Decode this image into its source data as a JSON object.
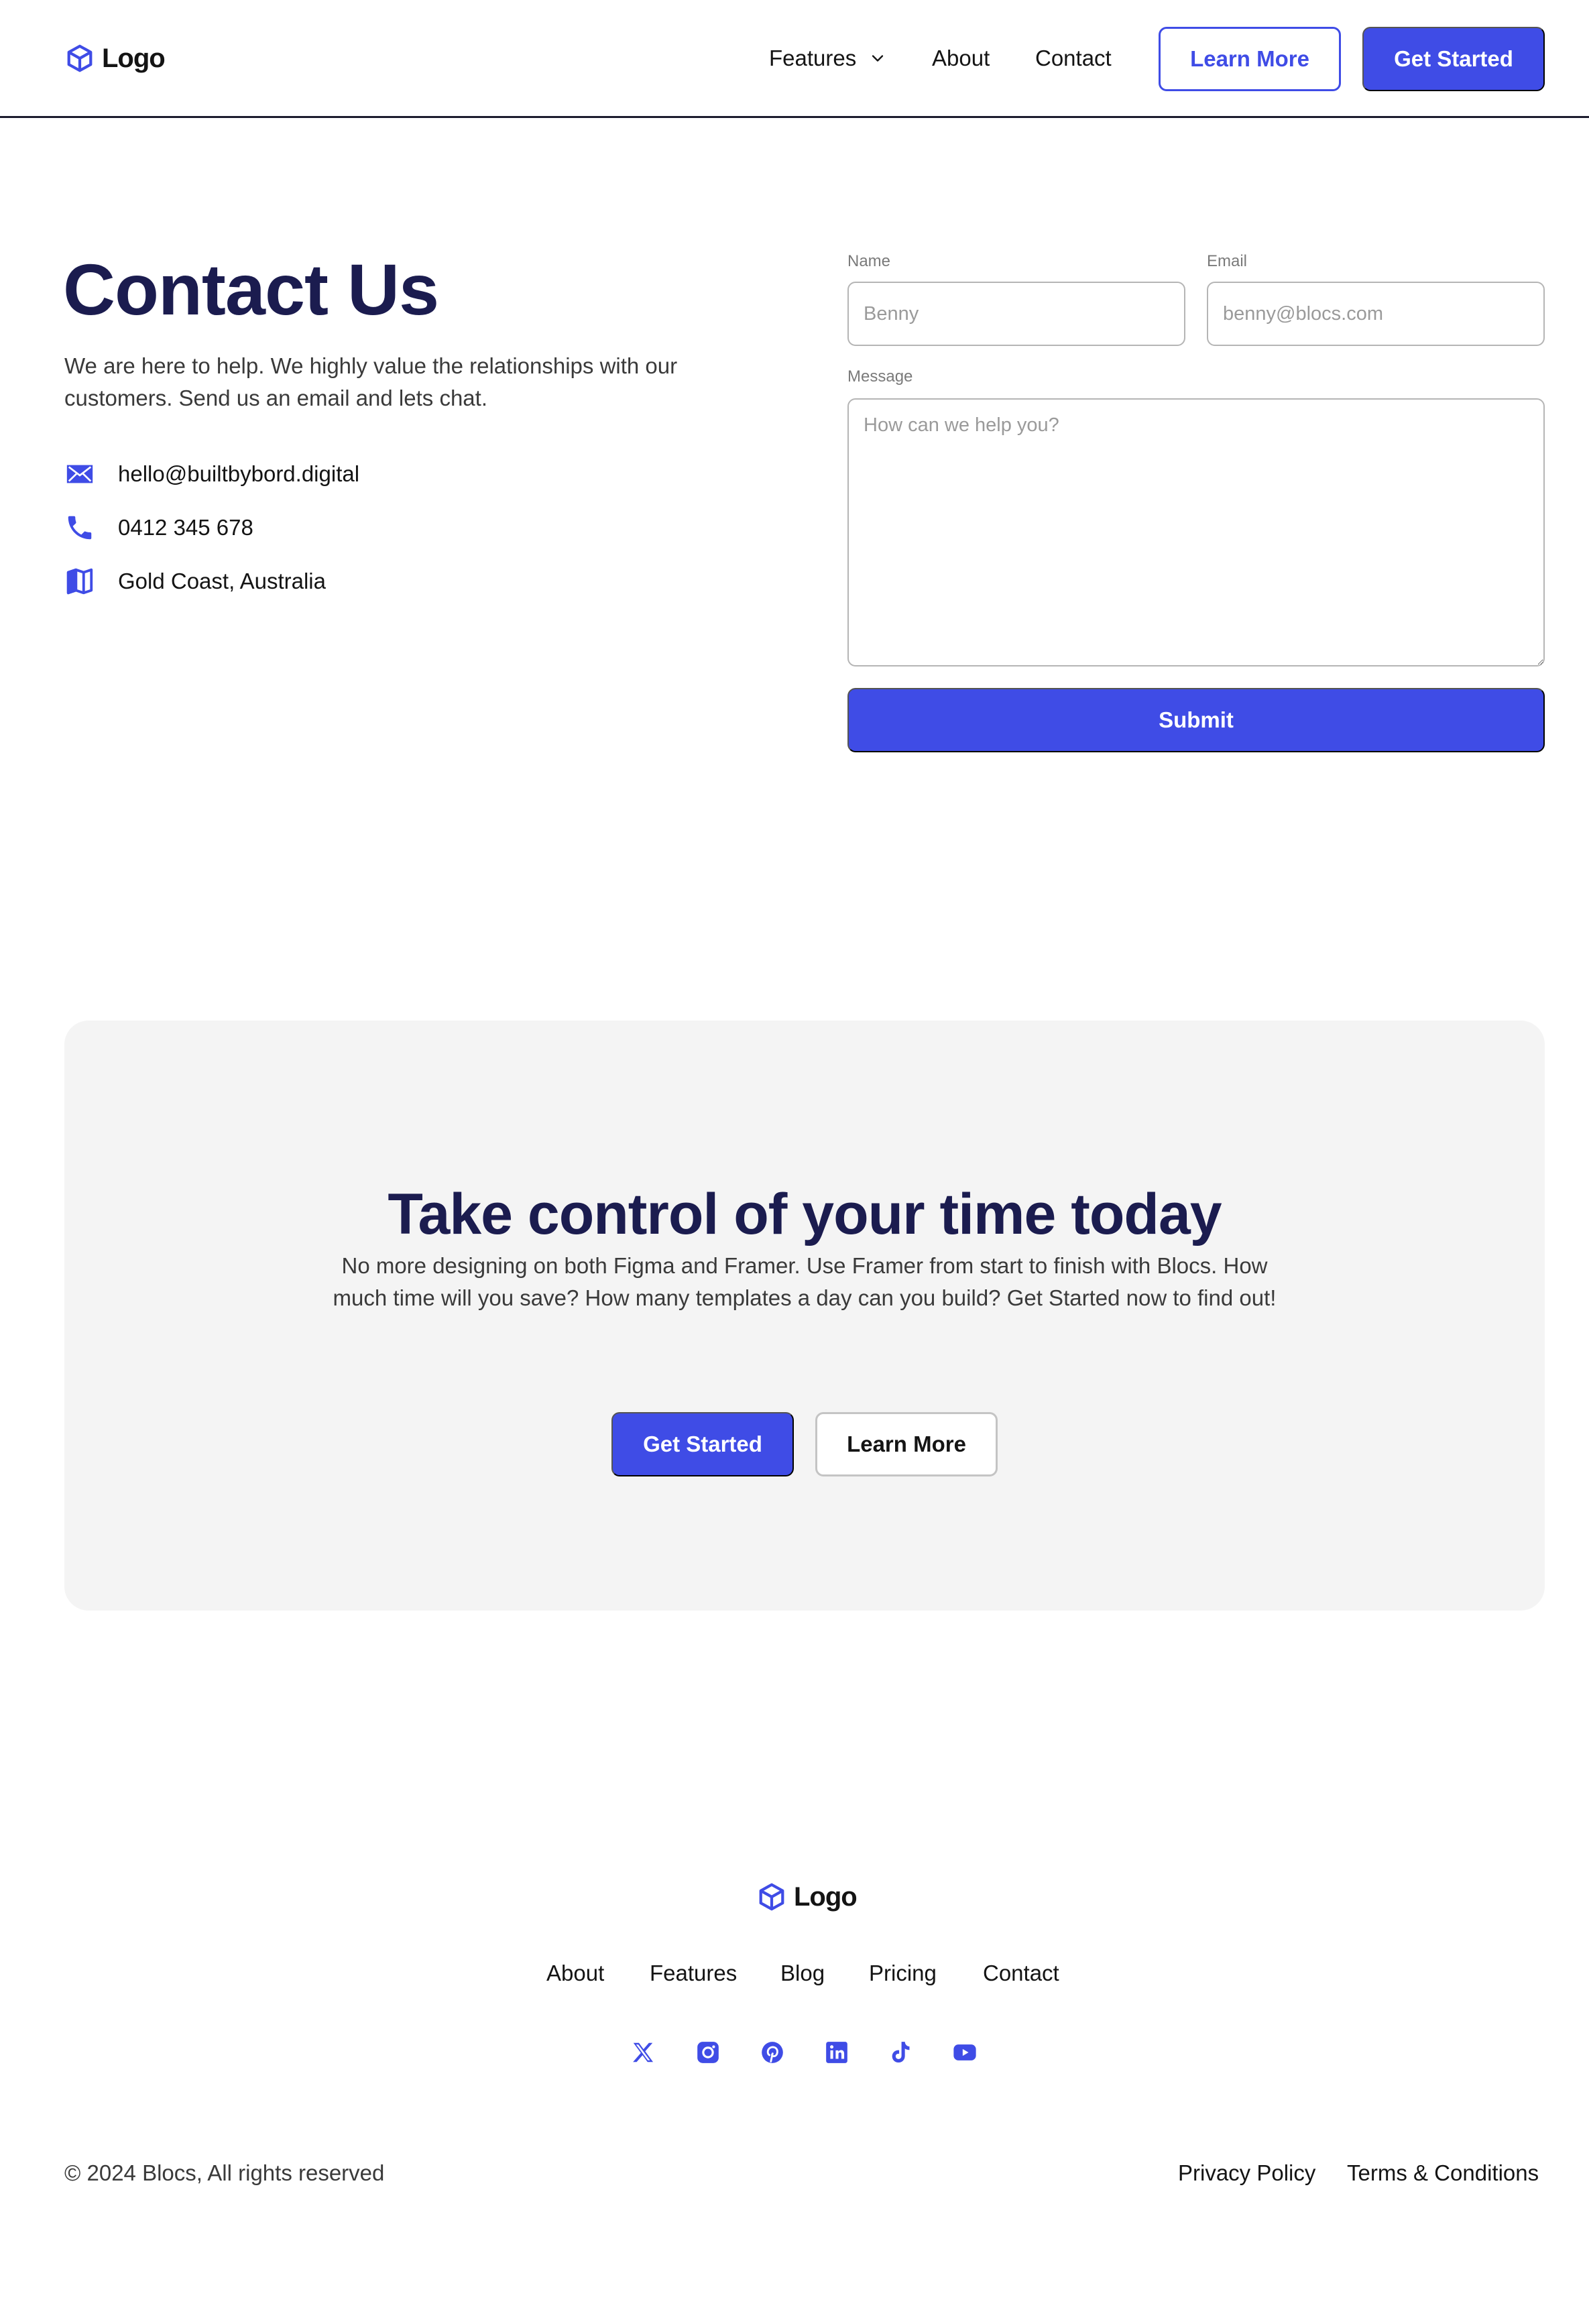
{
  "header": {
    "logo_text": "Logo",
    "nav": {
      "features": "Features",
      "about": "About",
      "contact": "Contact"
    },
    "learn_more": "Learn More",
    "get_started": "Get Started"
  },
  "contact": {
    "title": "Contact Us",
    "description": "We are here to help. We highly value the relationships with our customers. Send us an email and lets chat.",
    "email": "hello@builtbybord.digital",
    "phone": "0412 345 678",
    "address": "Gold Coast, Australia"
  },
  "form": {
    "name_label": "Name",
    "name_placeholder": "Benny",
    "email_label": "Email",
    "email_placeholder": "benny@blocs.com",
    "message_label": "Message",
    "message_placeholder": "How can we help you?",
    "submit": "Submit"
  },
  "cta": {
    "title": "Take control of your time today",
    "description": "No more designing on both Figma and Framer. Use Framer from start to finish with Blocs. How much time will you save? How many templates a day can you build? Get Started now to find out!",
    "get_started": "Get Started",
    "learn_more": "Learn More"
  },
  "footer": {
    "logo_text": "Logo",
    "nav": [
      "About",
      "Features",
      "Blog",
      "Pricing",
      "Contact"
    ],
    "social_icons": [
      "x-icon",
      "instagram-icon",
      "pinterest-icon",
      "linkedin-icon",
      "tiktok-icon",
      "youtube-icon"
    ],
    "copyright": "© 2024 Blocs, All rights reserved",
    "privacy": "Privacy Policy",
    "terms": "Terms & Conditions"
  },
  "colors": {
    "accent": "#3f4ce6",
    "heading": "#1b1c4f",
    "cta_background": "#f4f4f4"
  }
}
